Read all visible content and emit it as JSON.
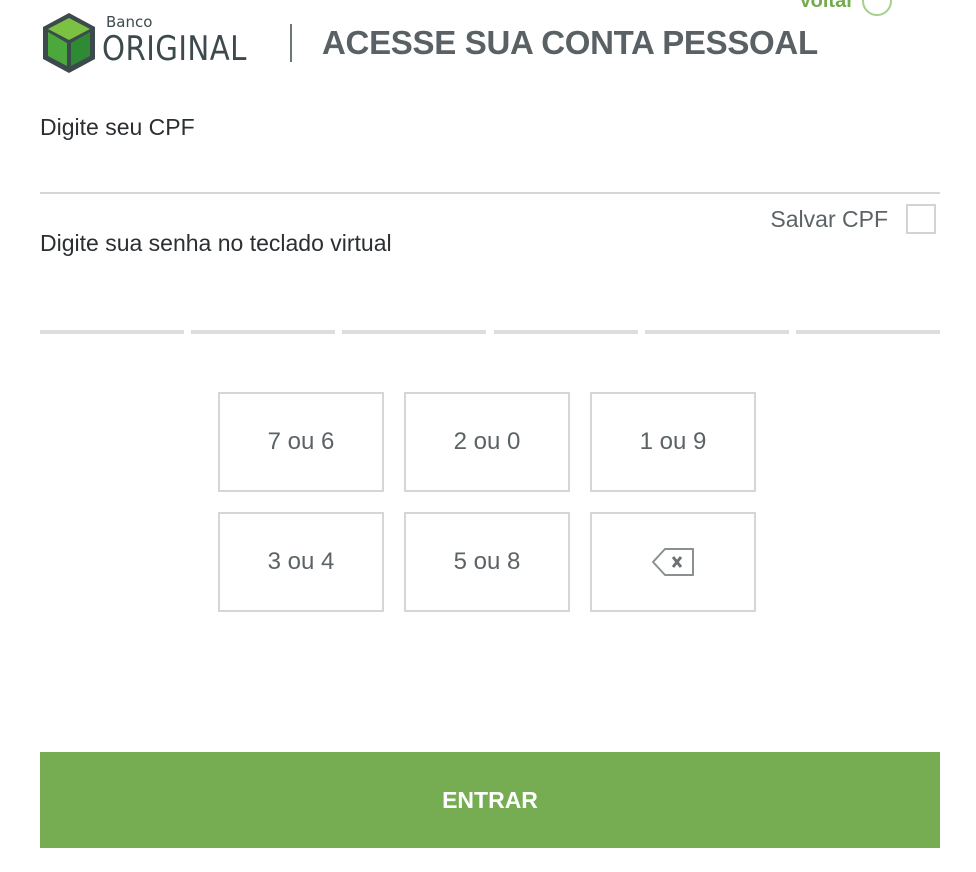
{
  "header": {
    "back_label": "Voltar",
    "brand_small": "Banco",
    "brand_large": "ORIGINAL",
    "title": "ACESSE SUA CONTA PESSOAL"
  },
  "cpf": {
    "label": "Digite seu CPF",
    "value": "",
    "placeholder": ""
  },
  "save_cpf": {
    "label": "Salvar CPF",
    "checked": false
  },
  "password": {
    "label": "Digite sua senha no teclado virtual",
    "slot_count": 6
  },
  "keypad": {
    "keys": [
      "7 ou 6",
      "2 ou 0",
      "1 ou 9",
      "3 ou 4",
      "5 ou 8"
    ],
    "backspace_icon": "backspace-icon"
  },
  "submit": {
    "label": "ENTRAR"
  },
  "colors": {
    "brand_green": "#76ad53",
    "text_dark": "#2b2f31",
    "text_gray": "#5c6366",
    "border_gray": "#d6d6d6"
  }
}
